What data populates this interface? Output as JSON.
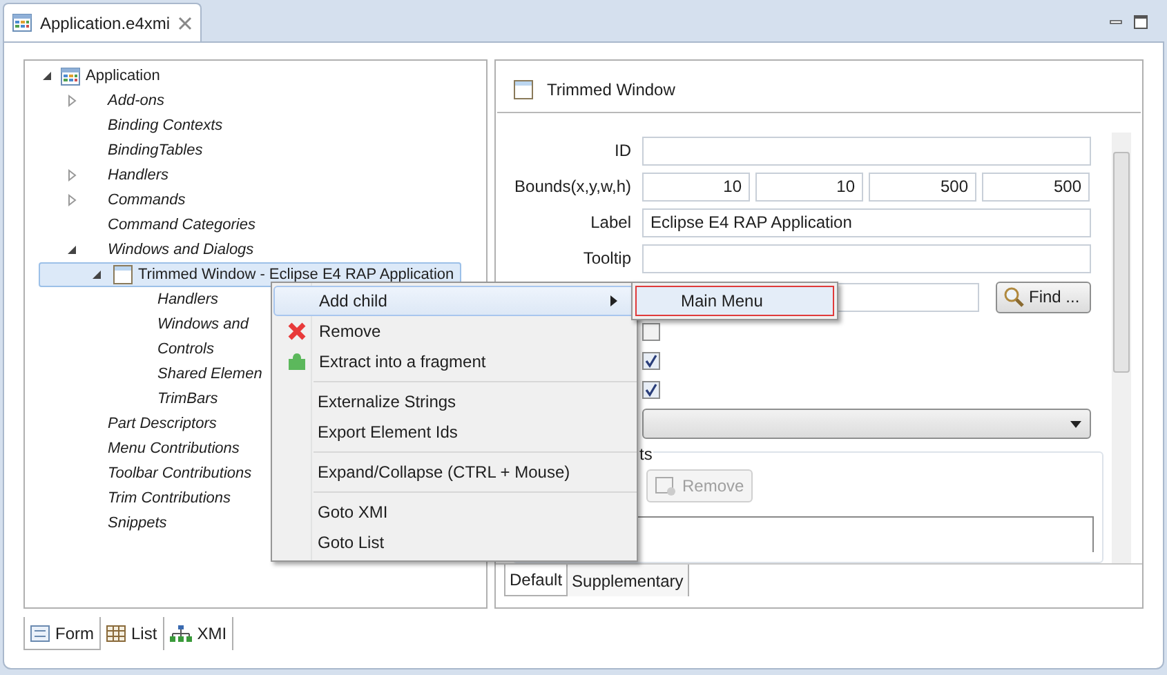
{
  "editor_tab": {
    "title": "Application.e4xmi"
  },
  "tree": [
    {
      "label": "Application",
      "kind": "root",
      "expanded": true,
      "selected": false,
      "children": [
        {
          "label": "Add-ons",
          "kind": "category",
          "expanded": false,
          "selected": false
        },
        {
          "label": "Binding Contexts",
          "kind": "category",
          "selected": false
        },
        {
          "label": "BindingTables",
          "kind": "category",
          "selected": false
        },
        {
          "label": "Handlers",
          "kind": "category",
          "expanded": false,
          "selected": false
        },
        {
          "label": "Commands",
          "kind": "category",
          "expanded": false,
          "selected": false
        },
        {
          "label": "Command Categories",
          "kind": "category",
          "selected": false
        },
        {
          "label": "Windows and Dialogs",
          "kind": "category",
          "expanded": true,
          "selected": false,
          "children": [
            {
              "label": "Trimmed Window - Eclipse E4 RAP Application",
              "kind": "window",
              "expanded": true,
              "selected": true,
              "children": [
                {
                  "label": "Handlers",
                  "kind": "category",
                  "selected": false
                },
                {
                  "label": "Windows and",
                  "kind": "category",
                  "selected": false
                },
                {
                  "label": "Controls",
                  "kind": "category",
                  "selected": false
                },
                {
                  "label": "Shared Elemen",
                  "kind": "category",
                  "selected": false
                },
                {
                  "label": "TrimBars",
                  "kind": "category",
                  "selected": false
                }
              ]
            }
          ]
        },
        {
          "label": "Part Descriptors",
          "kind": "category",
          "selected": false
        },
        {
          "label": "Menu Contributions",
          "kind": "category",
          "selected": false
        },
        {
          "label": "Toolbar Contributions",
          "kind": "category",
          "selected": false
        },
        {
          "label": "Trim Contributions",
          "kind": "category",
          "selected": false
        },
        {
          "label": "Snippets",
          "kind": "category",
          "selected": false
        }
      ]
    }
  ],
  "form": {
    "title": "Trimmed Window",
    "fields": [
      {
        "kind": "text",
        "label": "ID"
      },
      {
        "kind": "bounds",
        "label": "Bounds(x,y,w,h)",
        "values": [
          "10",
          "10",
          "500",
          "500"
        ]
      },
      {
        "kind": "text",
        "label": "Label",
        "value": "Eclipse E4 RAP Application"
      },
      {
        "kind": "text",
        "label": "Tooltip"
      },
      {
        "kind": "find",
        "button": "Find ..."
      },
      {
        "kind": "checkbox",
        "checked": false
      },
      {
        "kind": "checkbox",
        "checked": true
      },
      {
        "kind": "checkbox",
        "checked": true
      },
      {
        "kind": "combo"
      }
    ],
    "group": {
      "title": "ts",
      "button": {
        "label": "Remove",
        "disabled": true
      }
    },
    "tabs": [
      {
        "label": "Default",
        "selected": true
      },
      {
        "label": "Supplementary",
        "selected": false
      }
    ]
  },
  "bottom_tabs": [
    {
      "label": "Form",
      "selected": true
    },
    {
      "label": "List",
      "selected": false
    },
    {
      "label": "XMI",
      "selected": false
    }
  ],
  "context_menu": {
    "groups": [
      [
        {
          "label": "Add child",
          "selected": true,
          "submenu": true
        },
        {
          "label": "Remove",
          "selected": false
        },
        {
          "label": "Extract into a fragment",
          "selected": false
        }
      ],
      [
        {
          "label": "Externalize Strings",
          "selected": false
        },
        {
          "label": "Export Element Ids",
          "selected": false
        }
      ],
      [
        {
          "label": "Expand/Collapse (CTRL + Mouse)",
          "selected": false
        }
      ],
      [
        {
          "label": "Goto XMI",
          "selected": false
        },
        {
          "label": "Goto List",
          "selected": false
        }
      ]
    ]
  },
  "submenu": {
    "items": [
      {
        "label": "Main Menu",
        "selected": true
      }
    ]
  }
}
